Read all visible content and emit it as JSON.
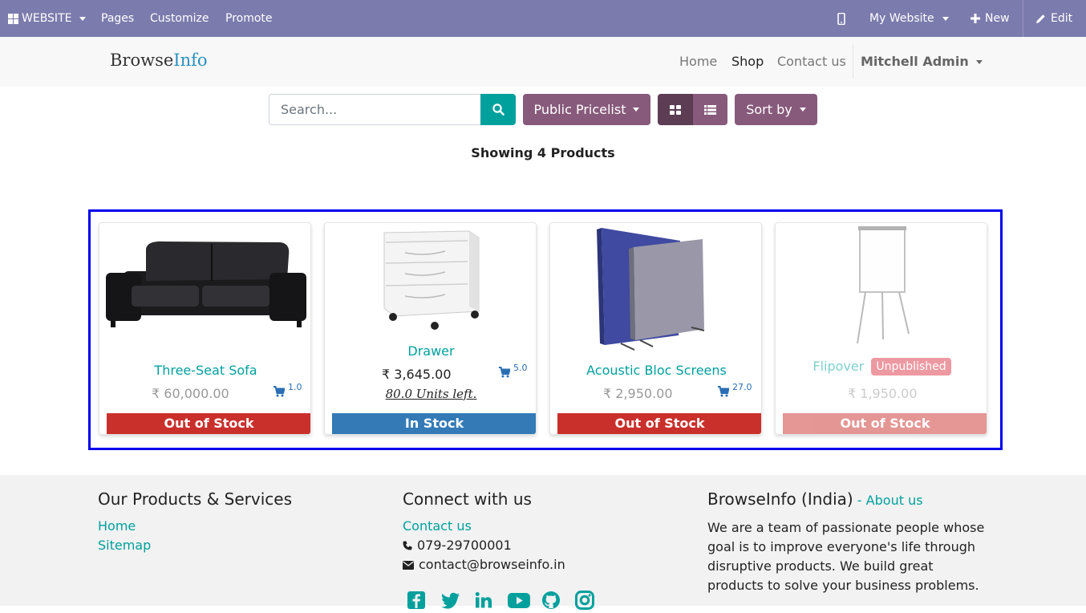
{
  "admin_bar": {
    "website_label": "WEBSITE",
    "pages": "Pages",
    "customize": "Customize",
    "promote": "Promote",
    "my_website": "My Website",
    "new": "New",
    "edit": "Edit"
  },
  "header": {
    "logo_part1": "Browse",
    "logo_part2": "Info",
    "nav": [
      "Home",
      "Shop",
      "Contact us"
    ],
    "active_nav": "Shop",
    "user": "Mitchell Admin"
  },
  "toolbar": {
    "search_placeholder": "Search...",
    "pricelist": "Public Pricelist",
    "sort": "Sort by"
  },
  "showing": "Showing 4 Products",
  "products": [
    {
      "name": "Three-Seat Sofa",
      "price": "₹ 60,000.00",
      "qty": "1.0",
      "stock": "Out of Stock"
    },
    {
      "name": "Drawer",
      "price": "₹ 3,645.00",
      "qty": "5.0",
      "units_left": "80.0 Units left.",
      "stock": "In Stock"
    },
    {
      "name": "Acoustic Bloc Screens",
      "price": "₹ 2,950.00",
      "qty": "27.0",
      "stock": "Out of Stock"
    },
    {
      "name": "Flipover",
      "badge": "Unpublished",
      "price": "₹ 1,950.00",
      "stock": "Out of Stock"
    }
  ],
  "footer": {
    "col1_title": "Our Products & Services",
    "col1_links": [
      "Home",
      "Sitemap"
    ],
    "col2_title": "Connect with us",
    "contact_link": "Contact us",
    "phone": "079-29700001",
    "email": "contact@browseinfo.in",
    "col3_title": "BrowseInfo (India)",
    "col3_dash": " - ",
    "about_link": "About us",
    "about_text": "We are a team of passionate people whose goal is to improve everyone's life through disruptive products. We build great products to solve your business problems.",
    "social_icons": [
      "facebook-icon",
      "twitter-icon",
      "linkedin-icon",
      "youtube-icon",
      "github-icon",
      "instagram-icon"
    ]
  },
  "colors": {
    "admin_bar": "#7c7bad",
    "primary": "#00a09d",
    "secondary": "#875a7b",
    "out_of_stock": "#c9302c",
    "in_stock": "#337ab7"
  }
}
